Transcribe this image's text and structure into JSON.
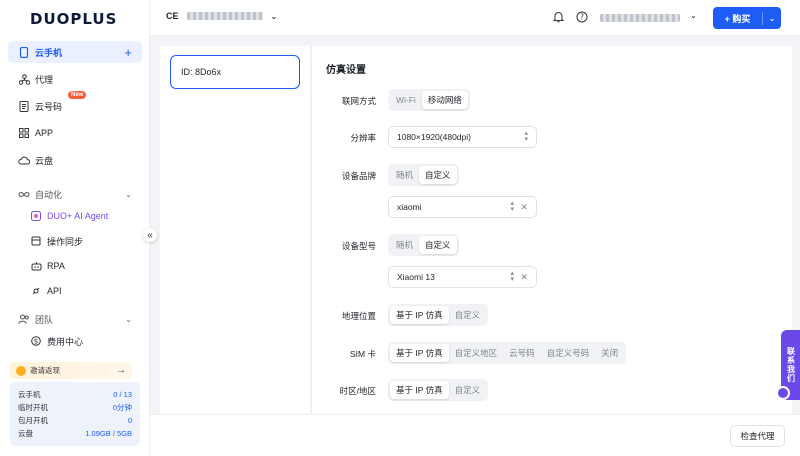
{
  "app": {
    "logo": "DUOPLUS"
  },
  "sidebar": {
    "items": [
      {
        "label": "云手机",
        "icon": "phone-icon"
      },
      {
        "label": "代理",
        "icon": "proxy-icon"
      },
      {
        "label": "云号码",
        "icon": "number-icon",
        "badge": "New"
      },
      {
        "label": "APP",
        "icon": "grid-icon"
      },
      {
        "label": "云盘",
        "icon": "cloud-icon"
      },
      {
        "label": "自动化",
        "icon": "infinity-icon"
      },
      {
        "label": "DUO+ AI Agent",
        "icon": "ai-icon"
      },
      {
        "label": "操作同步",
        "icon": "sync-icon"
      },
      {
        "label": "RPA",
        "icon": "robot-icon"
      },
      {
        "label": "API",
        "icon": "api-icon"
      },
      {
        "label": "团队",
        "icon": "team-icon"
      },
      {
        "label": "费用中心",
        "icon": "dollar-icon"
      }
    ],
    "invite": {
      "label": "邀请返现",
      "arrow": "→"
    },
    "quota": [
      {
        "label": "云手机",
        "value": "0 / 13"
      },
      {
        "label": "临时开机",
        "value": "0分钟"
      },
      {
        "label": "包月开机",
        "value": "0"
      },
      {
        "label": "云盘",
        "value": "1.09GB / 5GB"
      }
    ],
    "collapse": "«"
  },
  "header": {
    "org_initials": "CE",
    "buy_label": "购买",
    "buy_plus": "+"
  },
  "device": {
    "id_label": "ID: 8Do6x"
  },
  "settings": {
    "title": "仿真设置",
    "network": {
      "label": "联网方式",
      "options": [
        "Wi-Fi",
        "移动网络"
      ],
      "selected": 1
    },
    "resolution": {
      "label": "分辨率",
      "value": "1080×1920(480dpi)"
    },
    "brand": {
      "label": "设备品牌",
      "options": [
        "随机",
        "自定义"
      ],
      "selected": 1,
      "value": "xiaomi"
    },
    "model": {
      "label": "设备型号",
      "options": [
        "随机",
        "自定义"
      ],
      "selected": 1,
      "value": "Xiaomi 13"
    },
    "location": {
      "label": "地理位置",
      "options": [
        "基于 IP 仿真",
        "自定义"
      ],
      "selected": 0
    },
    "sim": {
      "label": "SIM 卡",
      "options": [
        "基于 IP 仿真",
        "自定义地区",
        "云号码",
        "自定义号码",
        "关闭"
      ],
      "selected": 0
    },
    "timezone": {
      "label": "时区/地区",
      "options": [
        "基于 IP 仿真",
        "自定义"
      ],
      "selected": 0
    }
  },
  "footer": {
    "check_proxy": "检查代理"
  },
  "contact": {
    "label": "联系我们"
  }
}
